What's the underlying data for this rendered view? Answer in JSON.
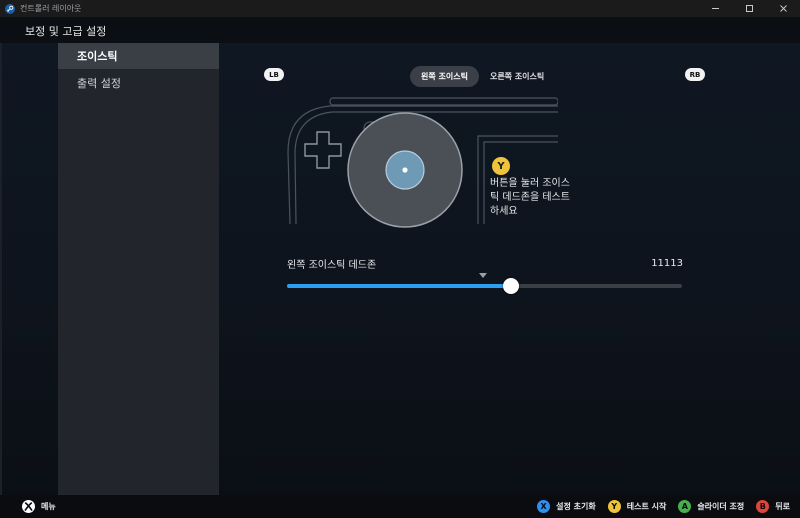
{
  "window": {
    "title": "컨트롤러 레이아웃",
    "icon": "steam-icon",
    "controls": [
      "minimize-icon",
      "maximize-icon",
      "close-icon"
    ]
  },
  "header": {
    "title": "보정 및 고급 설정"
  },
  "sidebar": {
    "items": [
      {
        "label": "조이스틱",
        "active": true
      },
      {
        "label": "출력 설정",
        "active": false
      }
    ]
  },
  "bumpers": {
    "left": "LB",
    "right": "RB"
  },
  "tabs": [
    {
      "label": "왼쪽 조이스틱",
      "active": true
    },
    {
      "label": "오른쪽 조이스틱",
      "active": false
    }
  ],
  "test_hint": {
    "button": "Y",
    "text": "버튼을 눌러 조이스틱 데드존을 테스트하세요"
  },
  "slider": {
    "label": "왼쪽 조이스틱 데드존",
    "value": "11113",
    "fill_fraction": 0.567
  },
  "footer": {
    "menu_label": "메뉴",
    "hints": [
      {
        "button": "X",
        "label": "설정 초기화",
        "color": "#2d8ff0"
      },
      {
        "button": "Y",
        "label": "테스트 시작",
        "color": "#f0c43a"
      },
      {
        "button": "A",
        "label": "슬라이더 조정",
        "color": "#48b04a"
      },
      {
        "button": "B",
        "label": "뒤로",
        "color": "#e0453a"
      }
    ]
  },
  "colors": {
    "accent": "#2d9ff0",
    "sidebar_bg": "#22262c",
    "sidebar_active": "#3a3f46"
  }
}
